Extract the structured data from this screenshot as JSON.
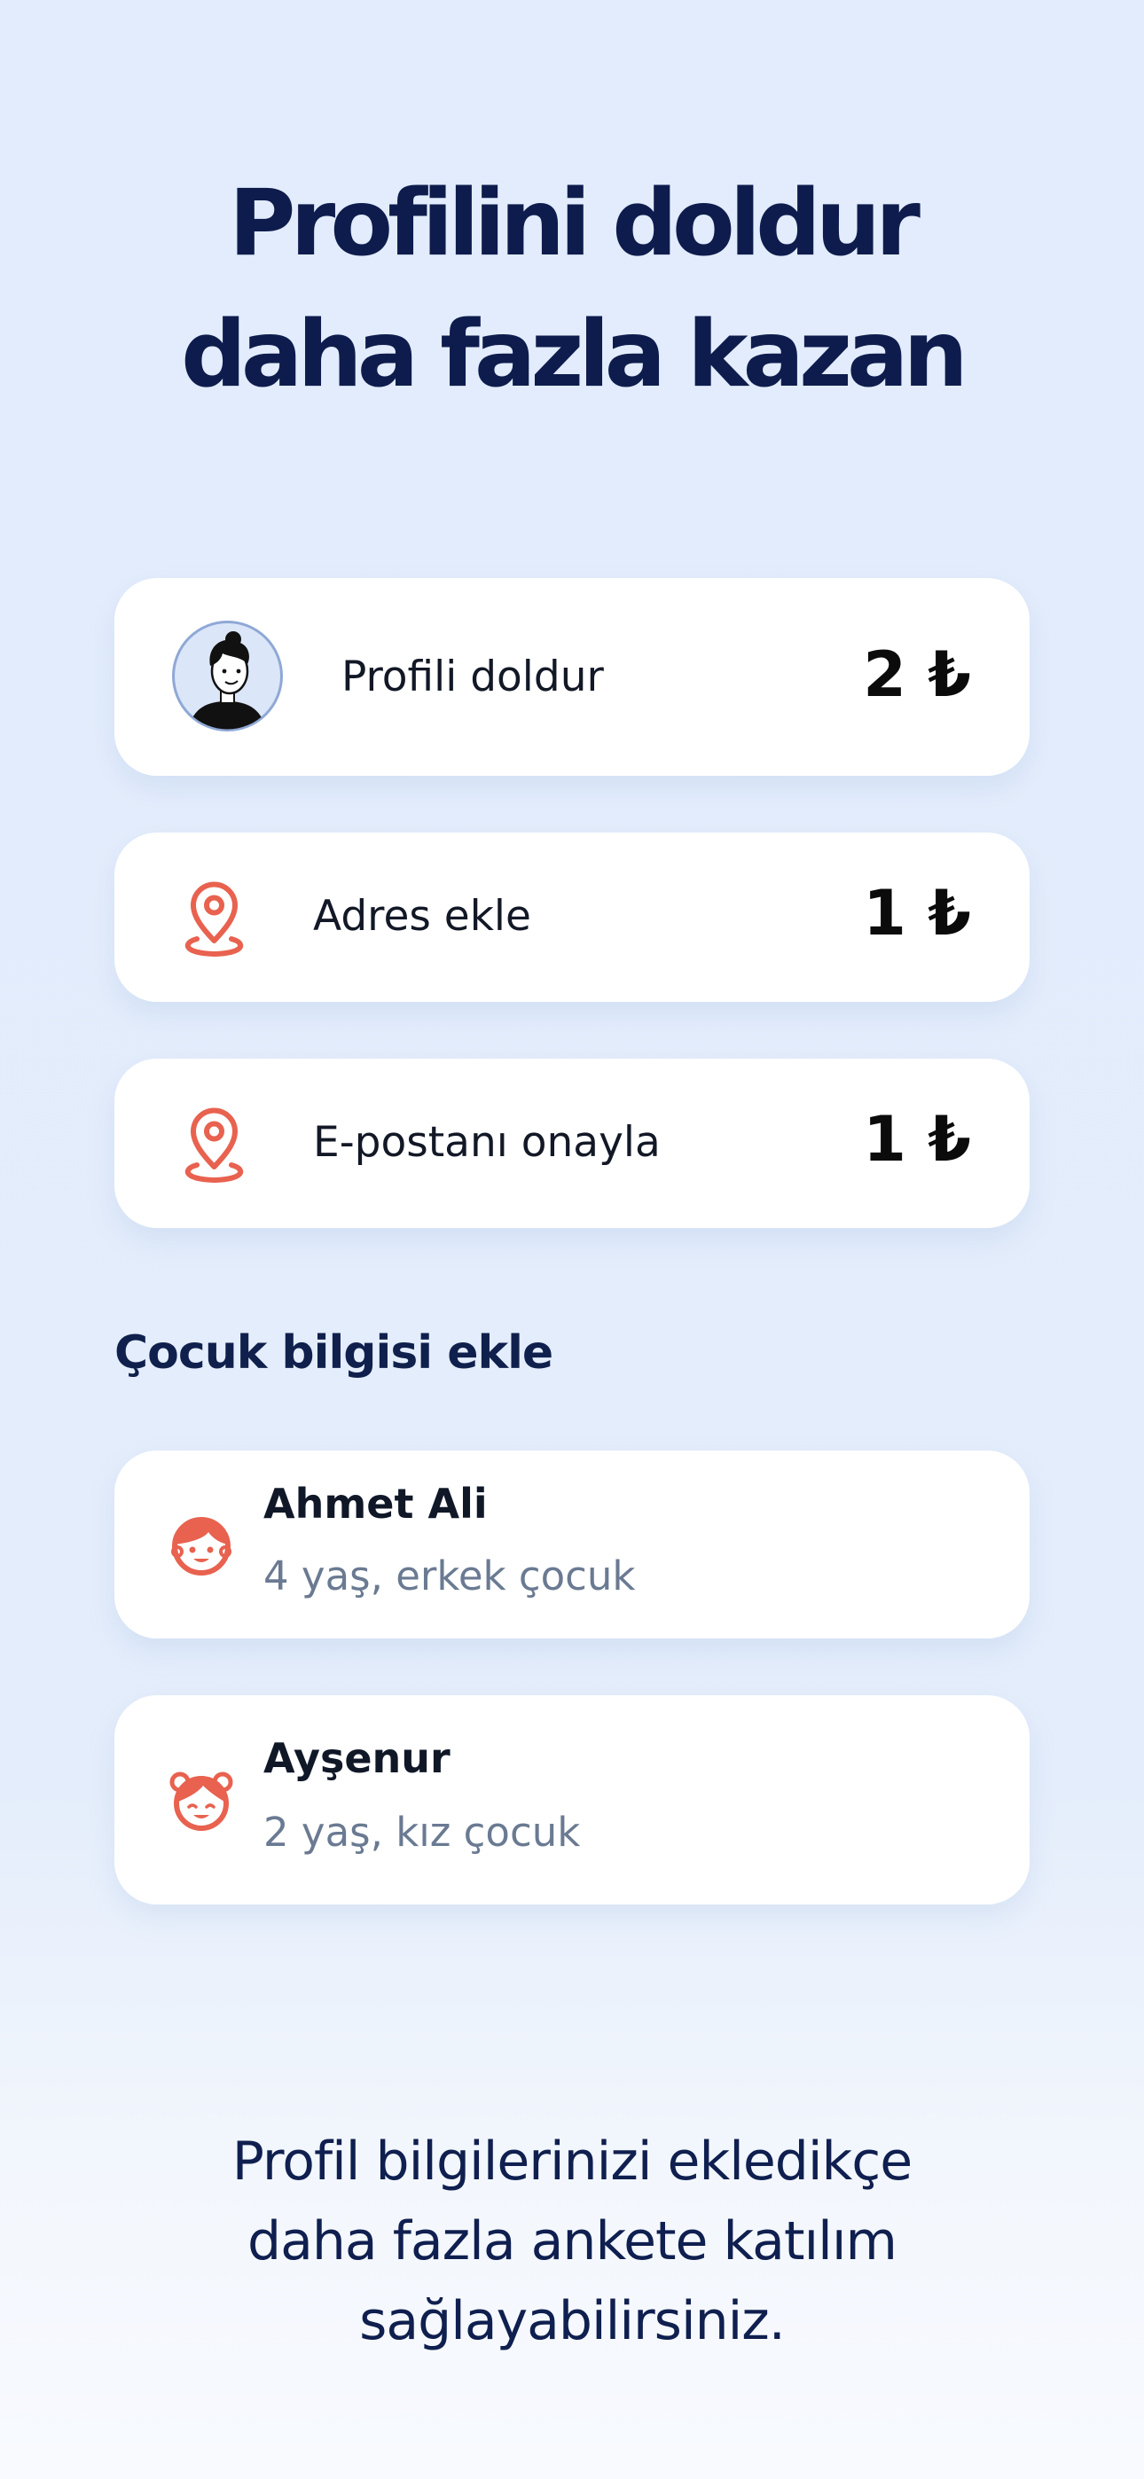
{
  "headline": {
    "line1": "Profilini doldur",
    "line2": "daha fazla kazan"
  },
  "tasks": [
    {
      "label": "Profili doldur",
      "reward": "2 ₺",
      "icon": "avatar-icon"
    },
    {
      "label": "Adres ekle",
      "reward": "1 ₺",
      "icon": "location-pin-icon"
    },
    {
      "label": "E-postanı onayla",
      "reward": "1 ₺",
      "icon": "location-pin-icon"
    }
  ],
  "children_section": {
    "title": "Çocuk bilgisi ekle",
    "children": [
      {
        "name": "Ahmet Ali",
        "details": "4 yaş, erkek çocuk",
        "icon": "boy-face-icon"
      },
      {
        "name": "Ayşenur",
        "details": "2 yaş, kız çocuk",
        "icon": "girl-face-icon"
      }
    ]
  },
  "footer": {
    "line1": "Profil bilgilerinizi ekledikçe",
    "line2": "daha fazla ankete katılım",
    "line3": "sağlayabilirsiniz."
  },
  "colors": {
    "accent": "#e8624f",
    "heading": "#0e1c4d",
    "background": "#e2ecfc"
  }
}
